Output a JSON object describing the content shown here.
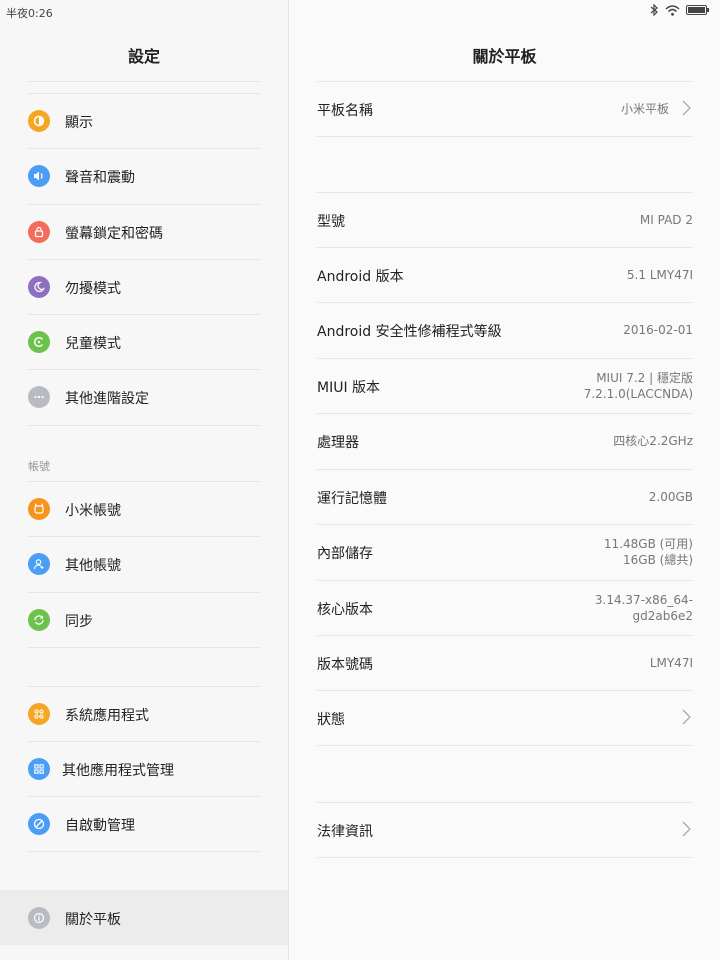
{
  "status_bar": {
    "time": "半夜0:26"
  },
  "left": {
    "title": "設定",
    "items": [
      {
        "label": "顯示",
        "icon": "display-icon",
        "color": "#f5a623"
      },
      {
        "label": "聲音和震動",
        "icon": "speaker-icon",
        "color": "#4a9ff5"
      },
      {
        "label": "螢幕鎖定和密碼",
        "icon": "lock-icon",
        "color": "#f36c5c"
      },
      {
        "label": "勿擾模式",
        "icon": "moon-icon",
        "color": "#8e6fc0"
      },
      {
        "label": "兒童模式",
        "icon": "child-icon",
        "color": "#6cc24a"
      },
      {
        "label": "其他進階設定",
        "icon": "more-icon",
        "color": "#b8bcc2"
      }
    ],
    "account_section": "帳號",
    "account_items": [
      {
        "label": "小米帳號",
        "icon": "mi-icon",
        "color": "#f7941d"
      },
      {
        "label": "其他帳號",
        "icon": "user-icon",
        "color": "#4a9ff5"
      },
      {
        "label": "同步",
        "icon": "sync-icon",
        "color": "#6cc24a"
      }
    ],
    "app_items": [
      {
        "label": "系統應用程式",
        "icon": "apps-icon",
        "color": "#f5a623"
      },
      {
        "label": "其他應用程式管理",
        "icon": "apps-grid-icon",
        "color": "#4a9ff5"
      },
      {
        "label": "自啟動管理",
        "icon": "autostart-icon",
        "color": "#4a9ff5"
      }
    ],
    "about": {
      "label": "關於平板",
      "icon": "info-icon"
    }
  },
  "right": {
    "title": "關於平板",
    "device_name": {
      "label": "平板名稱",
      "value": "小米平板"
    },
    "rows": [
      {
        "label": "型號",
        "value": "MI PAD 2"
      },
      {
        "label": "Android 版本",
        "value": "5.1 LMY47I"
      },
      {
        "label": "Android 安全性修補程式等級",
        "value": "2016-02-01"
      },
      {
        "label": "MIUI 版本",
        "value1": "MIUI 7.2 | 穩定版",
        "value2": "7.2.1.0(LACCNDA)"
      },
      {
        "label": "處理器",
        "value": "四核心2.2GHz"
      },
      {
        "label": "運行記憶體",
        "value": "2.00GB"
      },
      {
        "label": "內部儲存",
        "value1": "11.48GB (可用)",
        "value2": "16GB (總共)"
      },
      {
        "label": "核心版本",
        "value1": "3.14.37-x86_64-",
        "value2": "gd2ab6e2"
      },
      {
        "label": "版本號碼",
        "value": "LMY47I"
      },
      {
        "label": "狀態",
        "value": ""
      }
    ],
    "legal": {
      "label": "法律資訊"
    }
  }
}
